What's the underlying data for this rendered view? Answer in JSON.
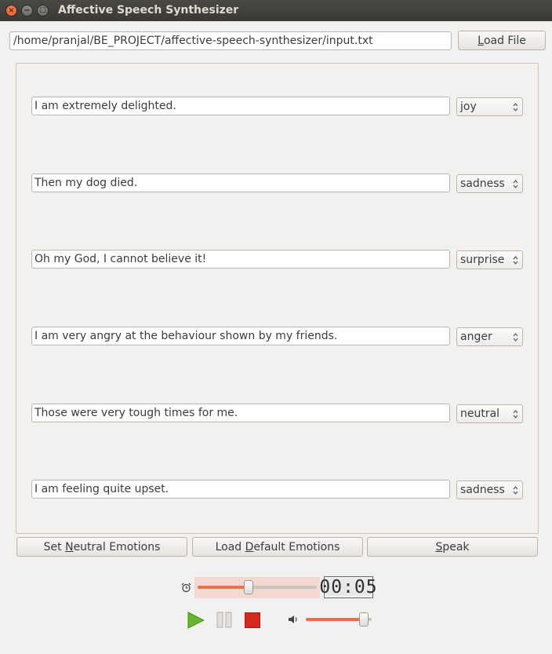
{
  "window": {
    "title": "Affective Speech Synthesizer",
    "close_glyph": "×",
    "minimize_glyph": "−",
    "maximize_glyph": "□"
  },
  "file": {
    "path": "/home/pranjal/BE_PROJECT/affective-speech-synthesizer/input.txt",
    "load_button_label": "Load File",
    "load_button_mnemonic": "L",
    "load_button_rest": "oad File"
  },
  "sentences": [
    {
      "text": "I am extremely delighted.",
      "emotion": "joy"
    },
    {
      "text": "Then my dog died.",
      "emotion": "sadness"
    },
    {
      "text": "Oh my God, I cannot believe it!",
      "emotion": "surprise"
    },
    {
      "text": "I am very angry at the behaviour shown by my friends.",
      "emotion": "anger"
    },
    {
      "text": "Those were very tough times for me.",
      "emotion": "neutral"
    },
    {
      "text": "I am feeling quite upset.",
      "emotion": "sadness"
    }
  ],
  "actions": {
    "set_neutral": {
      "pre": "Set ",
      "mnemonic": "N",
      "post": "eutral Emotions"
    },
    "load_default": {
      "pre": "Load ",
      "mnemonic": "D",
      "post": "efault Emotions"
    },
    "speak": {
      "pre": "",
      "mnemonic": "S",
      "post": "peak"
    }
  },
  "player": {
    "time_display": "00:05",
    "seek_progress": 0.42,
    "volume_level": 0.95,
    "icons": {
      "timer": "alarm-clock-icon",
      "play": "play-icon",
      "pause": "pause-icon",
      "stop": "stop-icon",
      "volume": "speaker-icon"
    },
    "colors": {
      "accent": "#e7714a",
      "play": "#67b52f",
      "stop": "#d42a1f"
    }
  }
}
